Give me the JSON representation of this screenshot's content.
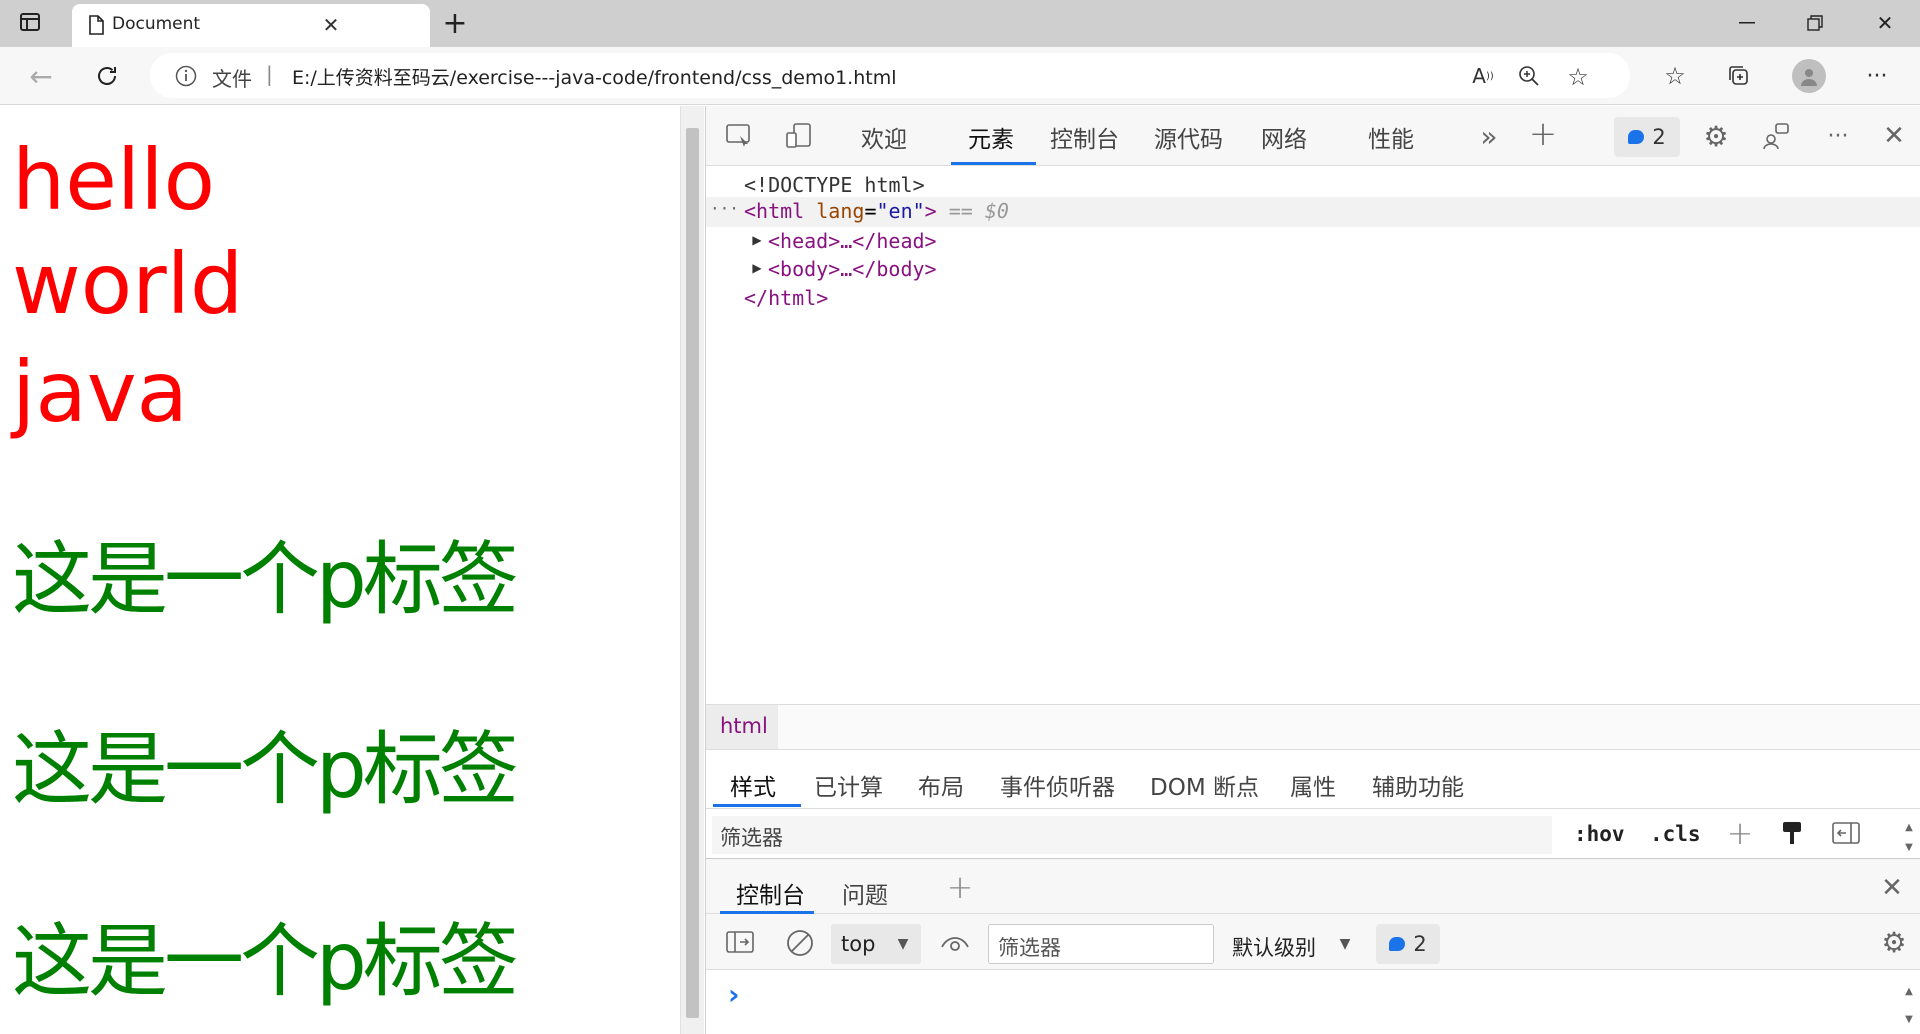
{
  "browser": {
    "tab_title": "Document",
    "address_info": "文件",
    "address_sep": "|",
    "url": "E:/上传资料至码云/exercise---java-code/frontend/css_demo1.html"
  },
  "page": {
    "red_lines": [
      "hello",
      "world",
      "java"
    ],
    "green_paragraphs": [
      "这是一个p标签",
      "这是一个p标签",
      "这是一个p标签"
    ],
    "colors": {
      "red": "#ff0000",
      "green": "#008000"
    }
  },
  "devtools": {
    "tabs": [
      "欢迎",
      "元素",
      "控制台",
      "源代码",
      "网络",
      "性能"
    ],
    "active_tab": "元素",
    "issues_count": "2",
    "dom": {
      "doctype": "<!DOCTYPE html>",
      "html_open_tag": "<html",
      "html_attr_name": "lang",
      "html_attr_value": "\"en\"",
      "html_close_bracket": ">",
      "selected_marker": "== $0",
      "head": "<head>…</head>",
      "body": "<body>…</body>",
      "html_close": "</html>",
      "dots": "···"
    },
    "breadcrumb": "html",
    "style_tabs": [
      "样式",
      "已计算",
      "布局",
      "事件侦听器",
      "DOM 断点",
      "属性",
      "辅助功能"
    ],
    "filter_placeholder": "筛选器",
    "hov": ":hov",
    "cls": ".cls",
    "drawer": {
      "tabs": [
        "控制台",
        "问题"
      ],
      "context": "top",
      "filter_placeholder": "筛选器",
      "level": "默认级别",
      "count": "2",
      "prompt": "›"
    }
  }
}
